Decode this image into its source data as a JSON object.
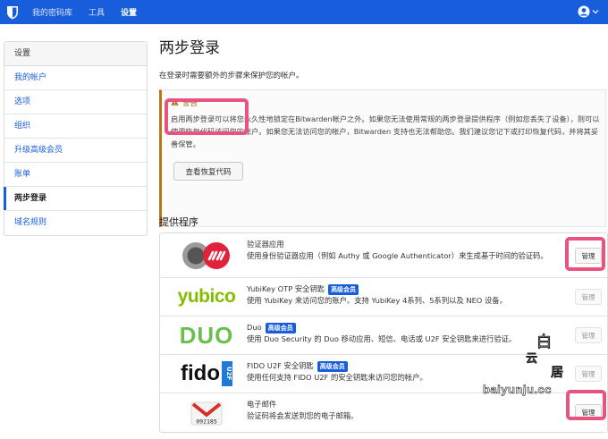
{
  "nav": {
    "items": [
      "我的密码库",
      "工具",
      "设置"
    ],
    "active": "设置"
  },
  "sidebar": {
    "header": "设置",
    "items": [
      {
        "label": "我的帐户"
      },
      {
        "label": "选项"
      },
      {
        "label": "组织"
      },
      {
        "label": "升级高级会员"
      },
      {
        "label": "账单"
      },
      {
        "label": "两步登录"
      },
      {
        "label": "域名规则"
      }
    ]
  },
  "page": {
    "title": "两步登录",
    "subtitle": "在登录时需要额外的步骤来保护您的帐户。"
  },
  "warning": {
    "title": "警告",
    "text": "启用两步登录可以将您永久性地锁定在Bitwarden帐户之外。如果您无法使用常规的两步登录提供程序（例如您丢失了设备），则可以使用恢复代码访问您的帐户。如果您无法访问您的帐户，Bitwarden 支持也无法帮助您。我们建议您记下或打印恢复代码，并将其妥善保管。",
    "button": "查看恢复代码"
  },
  "providers": {
    "title": "提供程序",
    "manage_label": "管理",
    "items": [
      {
        "name": "验证器应用",
        "badge": "",
        "desc": "使用身份验证器应用（例如 Authy 或 Google Authenticator）来生成基于时间的验证码。",
        "logo": "authy-google-logo",
        "enabled": true
      },
      {
        "name": "YubiKey OTP 安全钥匙",
        "badge": "高级会员",
        "desc": "使用 YubiKey 来访问您的账户。支持 YubiKey 4系列、5系列以及 NEO 设备。",
        "logo": "yubico",
        "enabled": false
      },
      {
        "name": "Duo",
        "badge": "高级会员",
        "desc": "使用 Duo Security 的 Duo 移动应用、短信、电话或 U2F 安全钥匙来进行验证。",
        "logo": "DUO",
        "enabled": false
      },
      {
        "name": "FIDO U2F 安全钥匙",
        "badge": "高级会员",
        "desc": "使用任何支持 FIDO U2F 的安全钥匙来访问您的帐户。",
        "logo": "fido",
        "enabled": false
      },
      {
        "name": "电子邮件",
        "badge": "",
        "desc": "验证码将会发送到您的电子邮箱。",
        "logo": "email-logo",
        "logo_text": "092185",
        "enabled": true
      }
    ]
  },
  "watermark": {
    "text": "baiyunju.cc",
    "glyphs": [
      "白",
      "云",
      "居"
    ]
  },
  "colors": {
    "brand": "#175DDC",
    "highlight": "#e9537f",
    "warning": "#b8751a"
  }
}
